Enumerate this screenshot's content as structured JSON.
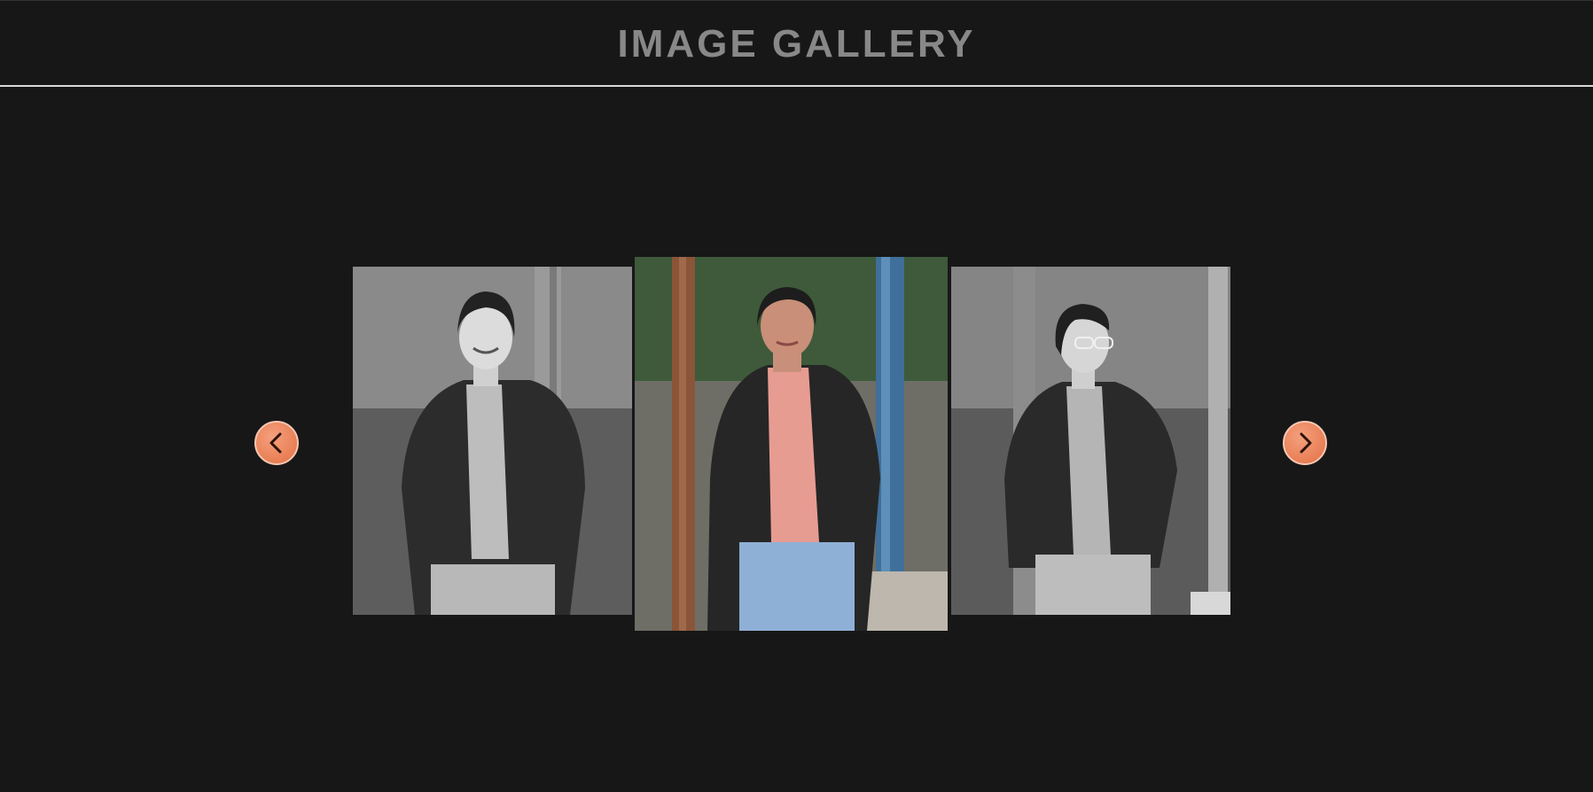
{
  "header": {
    "title": "IMAGE GALLERY"
  },
  "gallery": {
    "prev_icon": "chevron-left-icon",
    "next_icon": "chevron-right-icon",
    "nav_color": "#e97f55",
    "images": [
      {
        "position": "left",
        "style": "grayscale"
      },
      {
        "position": "center",
        "style": "color",
        "active": true
      },
      {
        "position": "right",
        "style": "grayscale"
      }
    ]
  }
}
